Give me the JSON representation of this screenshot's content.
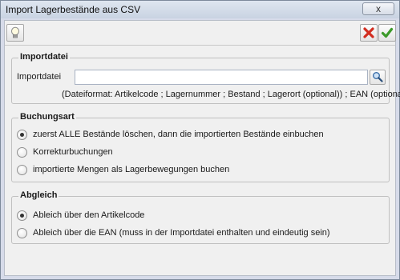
{
  "window": {
    "title": "Import Lagerbestände aus CSV",
    "close_label": "x"
  },
  "toolbar": {
    "help_icon": "lightbulb-icon",
    "cancel_icon": "red-x-icon",
    "ok_icon": "green-check-icon"
  },
  "importdatei": {
    "group_title": "Importdatei",
    "field_label": "Importdatei",
    "field_value": "",
    "browse_icon": "search-icon",
    "format_hint": "(Dateiformat: Artikelcode ; Lagernummer ; Bestand ; Lagerort (optional)) ; EAN (optional)"
  },
  "buchungsart": {
    "group_title": "Buchungsart",
    "options": [
      {
        "label": "zuerst ALLE Bestände löschen, dann die importierten Bestände einbuchen",
        "checked": true
      },
      {
        "label": "Korrekturbuchungen",
        "checked": false
      },
      {
        "label": "importierte Mengen als Lagerbewegungen buchen",
        "checked": false
      }
    ]
  },
  "abgleich": {
    "group_title": "Abgleich",
    "options": [
      {
        "label": "Ableich über den Artikelcode",
        "checked": true
      },
      {
        "label": "Ableich über die EAN (muss in der Importdatei enthalten und eindeutig sein)",
        "checked": false
      }
    ]
  }
}
